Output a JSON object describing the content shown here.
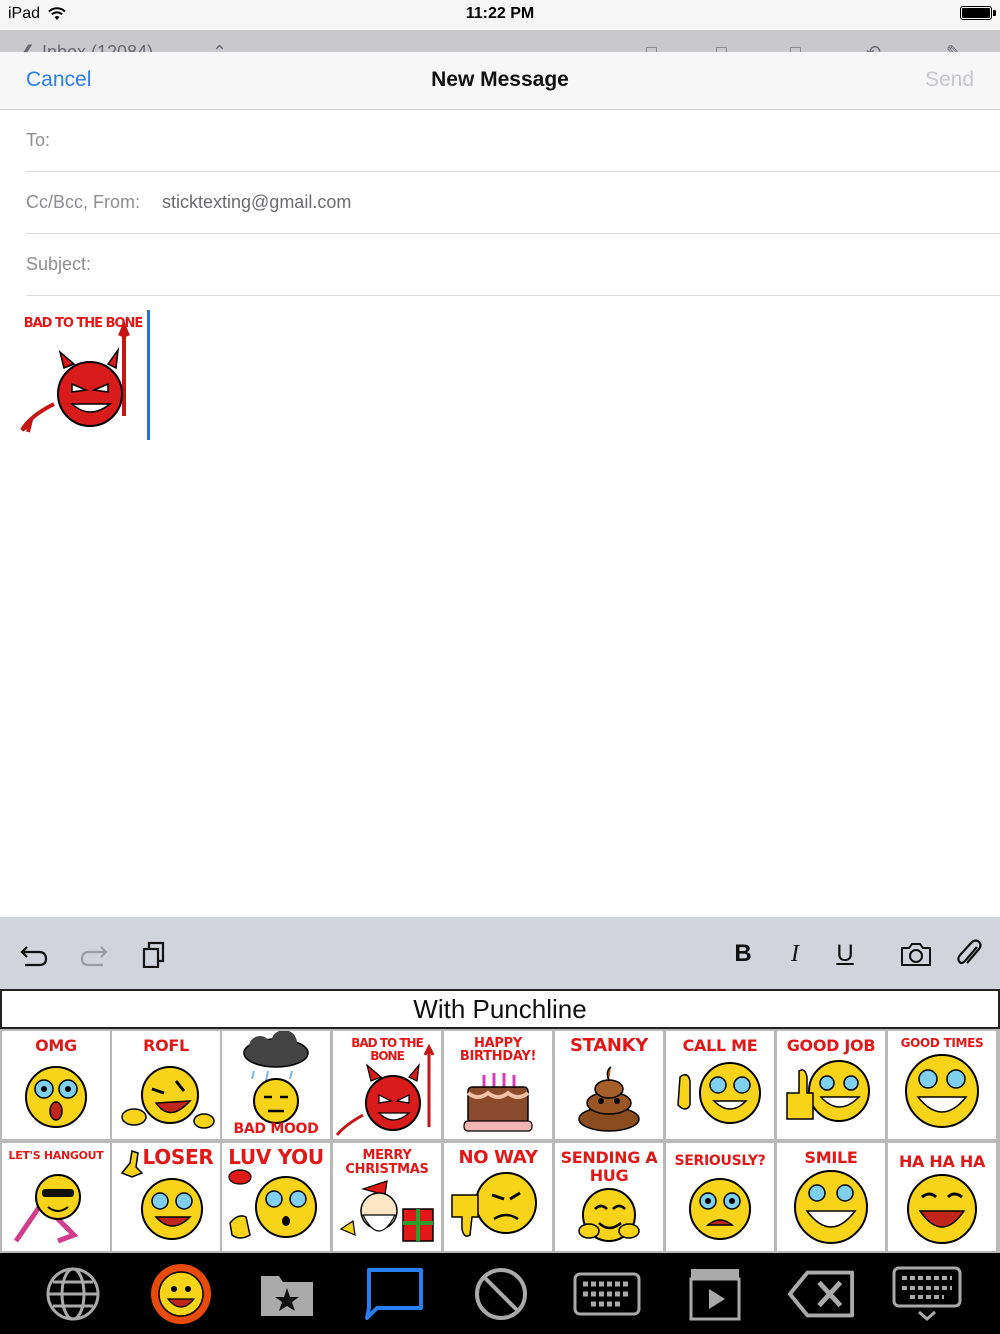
{
  "status": {
    "device": "iPad",
    "time": "11:22 PM"
  },
  "background": {
    "mailbox": "Inbox (12084)"
  },
  "compose": {
    "cancel": "Cancel",
    "title": "New Message",
    "send": "Send",
    "to_label": "To:",
    "ccbcc_label": "Cc/Bcc, From:",
    "from_value": "sticktexting@gmail.com",
    "subject_label": "Subject:",
    "inserted_sticker": "BAD TO THE BONE"
  },
  "format_bar": {
    "bold": "B",
    "italic": "I",
    "underline": "U"
  },
  "keyboard": {
    "category": "With Punchline",
    "stickers": [
      {
        "label": "OMG"
      },
      {
        "label": "ROFL"
      },
      {
        "label": "BAD MOOD"
      },
      {
        "label": "BAD TO THE BONE"
      },
      {
        "label": "HAPPY BIRTHDAY!"
      },
      {
        "label": "STANKY"
      },
      {
        "label": "CALL ME"
      },
      {
        "label": "GOOD JOB"
      },
      {
        "label": "GOOD TIMES"
      },
      {
        "label": "LET'S HANGOUT"
      },
      {
        "label": "LOSER"
      },
      {
        "label": "LUV YOU"
      },
      {
        "label": "MERRY CHRISTMAS"
      },
      {
        "label": "NO WAY"
      },
      {
        "label": "SENDING A HUG"
      },
      {
        "label": "SERIOUSLY?"
      },
      {
        "label": "SMILE"
      },
      {
        "label": "HA HA HA"
      }
    ],
    "dock_icons": [
      "globe-icon",
      "sun-emoji-icon",
      "favorites-folder-icon",
      "chat-bubble-icon",
      "block-icon",
      "keyboard-icon",
      "video-icon",
      "delete-icon",
      "hide-keyboard-icon"
    ]
  },
  "colors": {
    "accent": "#2a7ff0",
    "sticker_text": "#e01818",
    "emoji_yellow": "#f7d31a",
    "devil_red": "#d81b1b"
  }
}
